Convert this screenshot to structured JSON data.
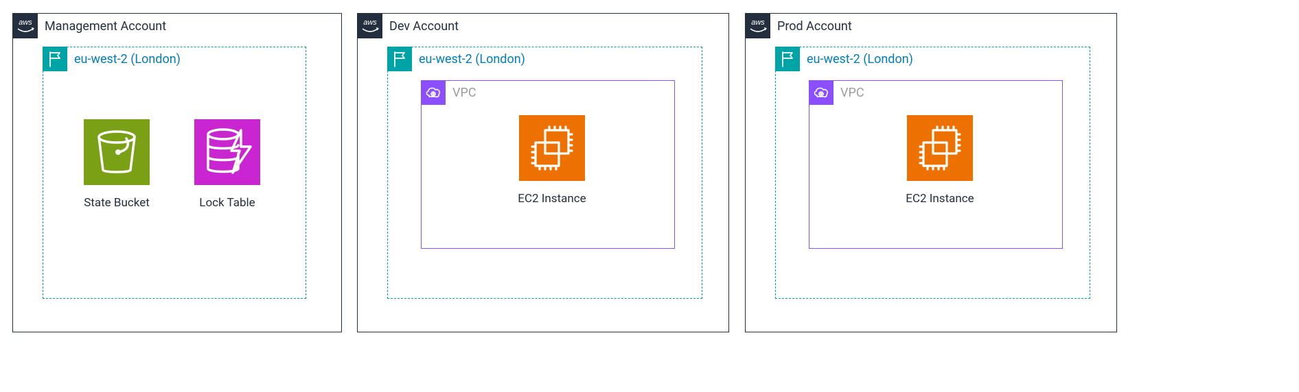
{
  "accounts": [
    {
      "title": "Management Account",
      "region": {
        "title": "eu-west-2 (London)"
      },
      "resources": {
        "s3": {
          "label": "State Bucket"
        },
        "ddb": {
          "label": "Lock Table"
        }
      }
    },
    {
      "title": "Dev Account",
      "region": {
        "title": "eu-west-2 (London)"
      },
      "vpc": {
        "title": "VPC"
      },
      "resources": {
        "ec2": {
          "label": "EC2 Instance"
        }
      }
    },
    {
      "title": "Prod Account",
      "region": {
        "title": "eu-west-2 (London)"
      },
      "vpc": {
        "title": "VPC"
      },
      "resources": {
        "ec2": {
          "label": "EC2 Instance"
        }
      }
    }
  ],
  "colors": {
    "cloud_border": "#232f3e",
    "region_teal": "#00a4a6",
    "region_link": "#007dba",
    "vpc_purple": "#8c4fff",
    "ec2_orange": "#ed7100",
    "s3_green": "#7aa116",
    "ddb_magenta": "#c925d1"
  }
}
